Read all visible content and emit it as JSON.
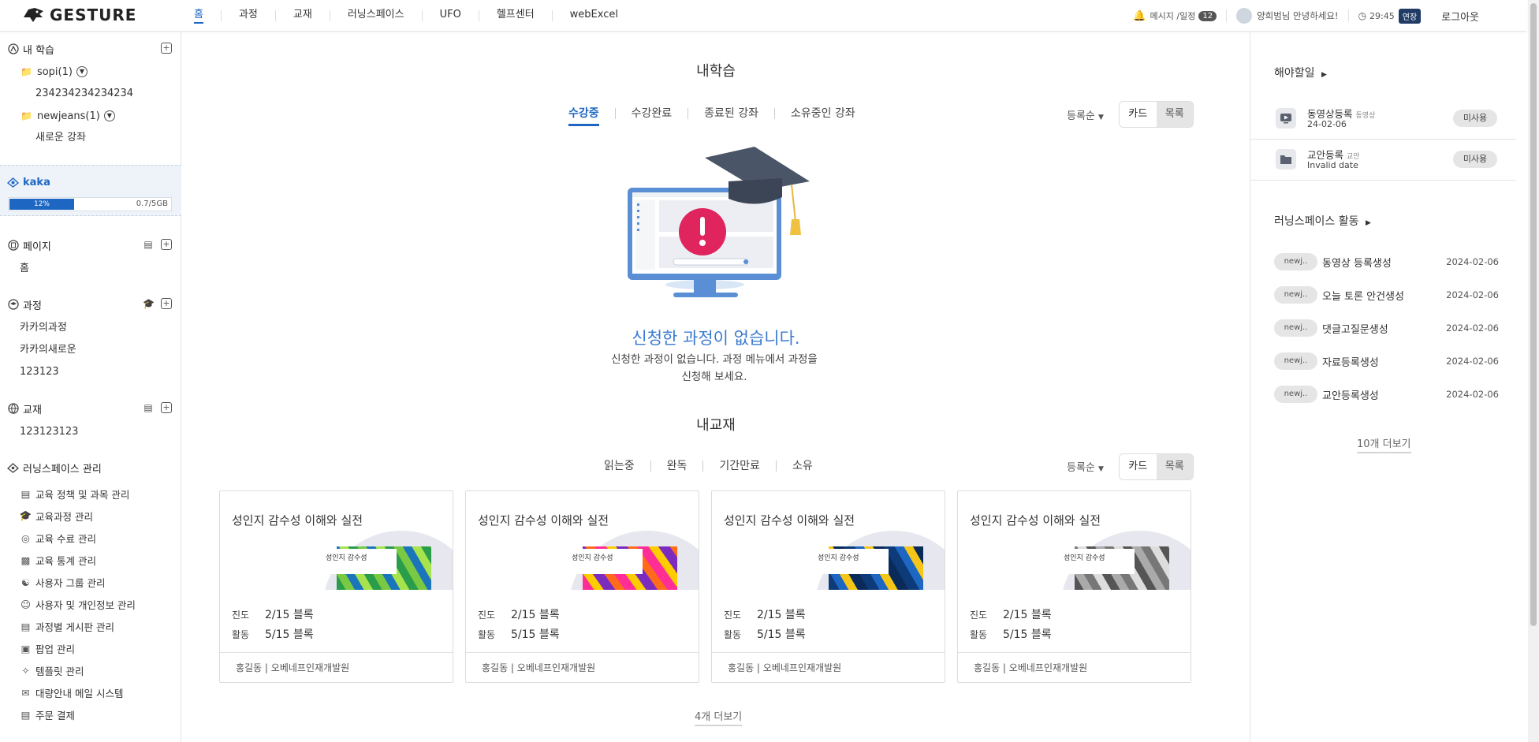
{
  "header": {
    "logo_text": "GESTURE",
    "nav": [
      "홈",
      "과정",
      "교재",
      "러닝스페이스",
      "UFO",
      "헬프센터",
      "webExcel"
    ],
    "messages_label": "메시지 /일정",
    "messages_count": "12",
    "greeting": "양희범님 안녕하세요!",
    "timer": "29:45",
    "extend_label": "연장",
    "logout_label": "로그아웃"
  },
  "sidebar": {
    "my_learning": {
      "title": "내 학습",
      "folders": [
        {
          "name": "sopi(1)",
          "children": [
            "234234234234234"
          ]
        },
        {
          "name": "newjeans(1)",
          "children": [
            "새로운 강좌"
          ]
        }
      ]
    },
    "space": {
      "name": "kaka",
      "usage_percent": "12%",
      "usage_text": "0.7/5GB"
    },
    "pages": {
      "title": "페이지",
      "items": [
        "홈"
      ]
    },
    "courses": {
      "title": "과정",
      "items": [
        "카카의과정",
        "카카의새로운",
        "123123"
      ]
    },
    "textbooks": {
      "title": "교재",
      "items": [
        "123123123"
      ]
    },
    "manage": {
      "title": "러닝스페이스 관리",
      "items": [
        "교육 정책 및 과목 관리",
        "교육과정 관리",
        "교육 수료 관리",
        "교육 통계 관리",
        "사용자 그룹 관리",
        "사용자 및 개인정보 관리",
        "과정별 게시판 관리",
        "팝업 관리",
        "템플릿 관리",
        "대량안내 메일 시스템",
        "주문 결제"
      ]
    }
  },
  "main": {
    "learning_title": "내학습",
    "learning_tabs": [
      "수강중",
      "수강완료",
      "종료된 강좌",
      "소유중인 강좌"
    ],
    "sort_label": "등록순",
    "view_card": "카드",
    "view_list": "목록",
    "empty_title": "신청한 과정이 없습니다.",
    "empty_desc": "신청한 과정이 없습니다. 과정 메뉴에서 과정을 신청해 보세요.",
    "textbook_title": "내교재",
    "textbook_tabs": [
      "읽는중",
      "완독",
      "기간만료",
      "소유"
    ],
    "cards": [
      {
        "title": "성인지 감수성 이해와 실전",
        "cover_label": "성인지 감수성",
        "progress_label": "진도",
        "progress": "2/15 블록",
        "activity_label": "활동",
        "activity": "5/15 블록",
        "author": "홍길동 | 오베네프인재개발원"
      },
      {
        "title": "성인지 감수성 이해와 실전",
        "cover_label": "성인지 감수성",
        "progress_label": "진도",
        "progress": "2/15 블록",
        "activity_label": "활동",
        "activity": "5/15 블록",
        "author": "홍길동 | 오베네프인재개발원"
      },
      {
        "title": "성인지 감수성 이해와 실전",
        "cover_label": "성인지 감수성",
        "progress_label": "진도",
        "progress": "2/15 블록",
        "activity_label": "활동",
        "activity": "5/15 블록",
        "author": "홍길동 | 오베네프인재개발원"
      },
      {
        "title": "성인지 감수성 이해와 실전",
        "cover_label": "성인지 감수성",
        "progress_label": "진도",
        "progress": "2/15 블록",
        "activity_label": "활동",
        "activity": "5/15 블록",
        "author": "홍길동 | 오베네프인재개발원"
      }
    ],
    "more_label": "4개 더보기"
  },
  "right": {
    "todo_title": "해야할일",
    "todos": [
      {
        "title": "동영상등록",
        "tag": "동영상",
        "date": "24-02-06",
        "status": "미사용"
      },
      {
        "title": "교안등록",
        "tag": "교안",
        "date": "Invalid date",
        "status": "미사용"
      }
    ],
    "activity_title": "러닝스페이스 활동",
    "activities": [
      {
        "tag": "newj..",
        "name": "동영상 등록생성",
        "date": "2024-02-06"
      },
      {
        "tag": "newj..",
        "name": "오늘 토론 안건생성",
        "date": "2024-02-06"
      },
      {
        "tag": "newj..",
        "name": "댓글고질문생성",
        "date": "2024-02-06"
      },
      {
        "tag": "newj..",
        "name": "자료등록생성",
        "date": "2024-02-06"
      },
      {
        "tag": "newj..",
        "name": "교안등록생성",
        "date": "2024-02-06"
      }
    ],
    "more_label": "10개 더보기"
  },
  "colors": {
    "accent": "#1d67c2",
    "empty_title": "#3a7bd0",
    "timer_badge": "#1f3b66"
  }
}
